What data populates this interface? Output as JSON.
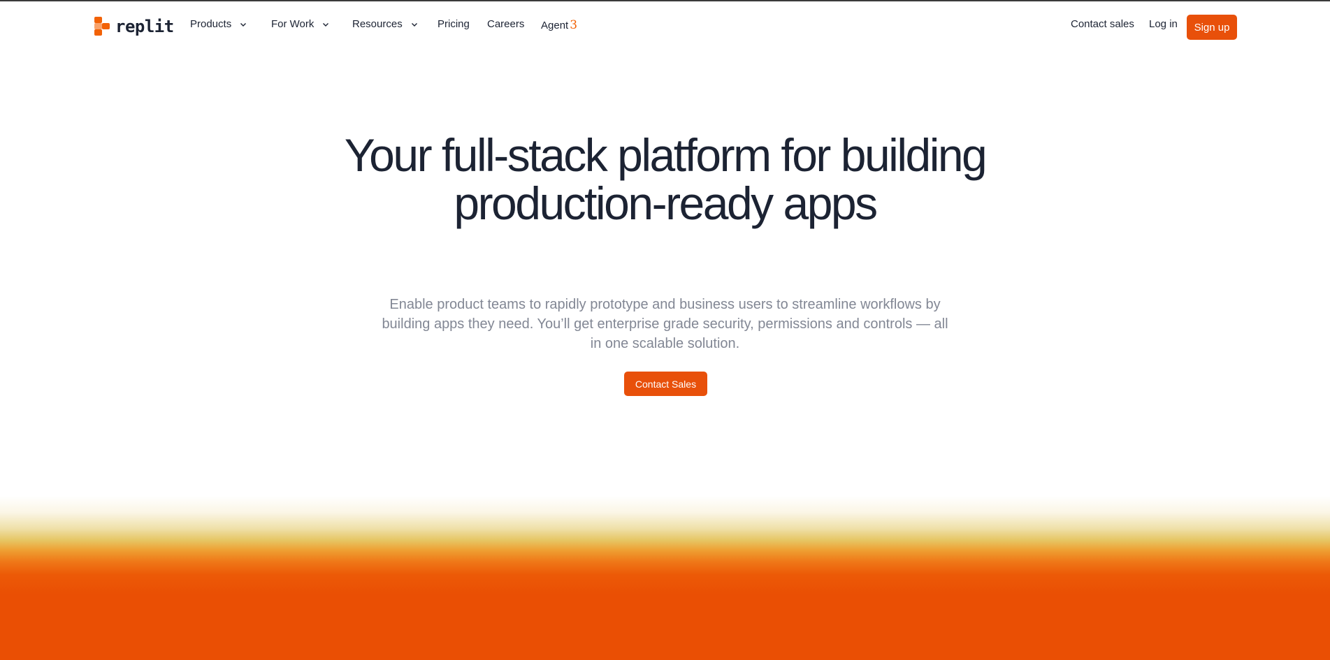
{
  "brand": {
    "name": "replit",
    "accent": "#e8500a"
  },
  "nav": {
    "items": [
      {
        "label": "Products",
        "has_dropdown": true
      },
      {
        "label": "For Work",
        "has_dropdown": true
      },
      {
        "label": "Resources",
        "has_dropdown": true
      },
      {
        "label": "Pricing",
        "has_dropdown": false
      },
      {
        "label": "Careers",
        "has_dropdown": false
      }
    ],
    "agent": {
      "label": "Agent",
      "version": "3"
    },
    "contact_sales": "Contact sales",
    "login": "Log in",
    "signup": "Sign up"
  },
  "hero": {
    "title": "Your full-stack platform for building production-ready apps",
    "subtitle": "Enable product teams to rapidly prototype and business users to streamline workflows by building apps they need. You’ll get enterprise grade security, permissions and controls — all in one scalable solution.",
    "cta": "Contact Sales"
  }
}
